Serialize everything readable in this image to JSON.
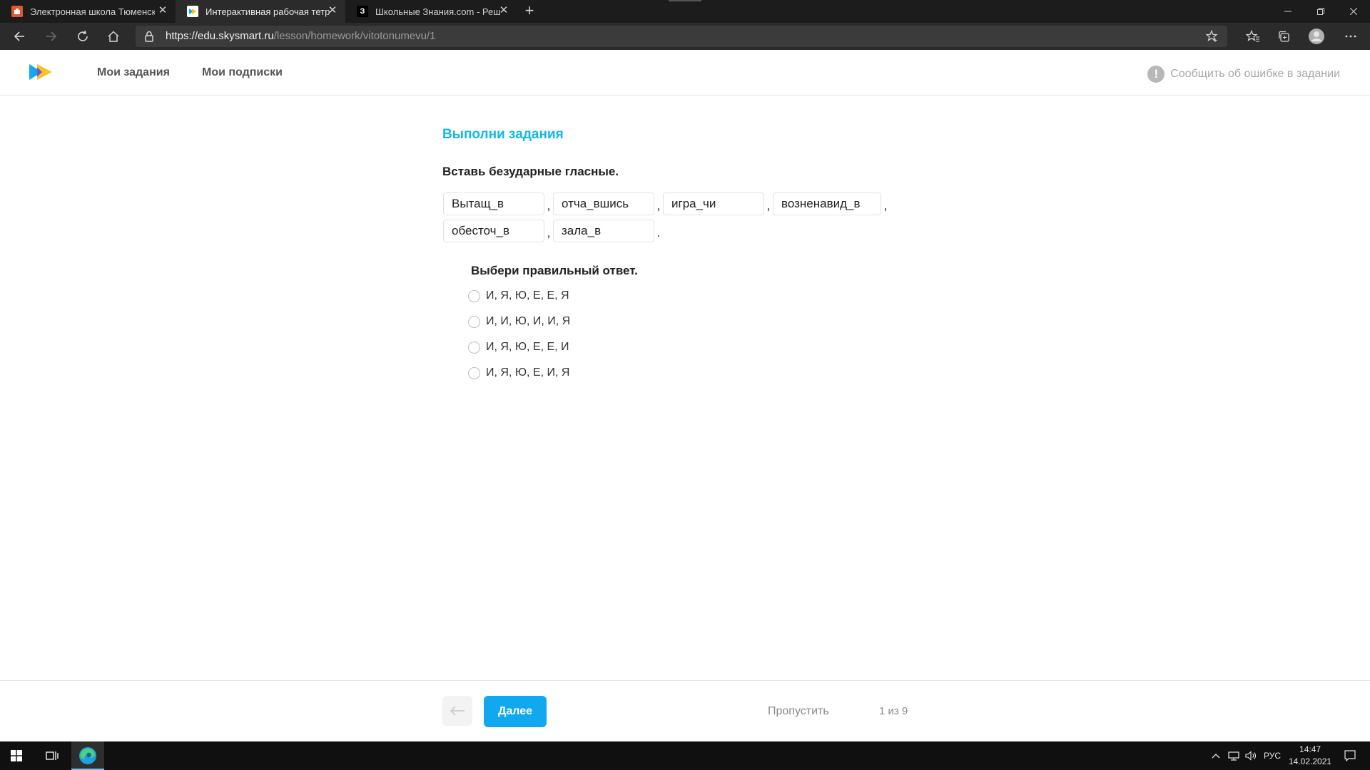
{
  "browser": {
    "tabs": [
      {
        "title": "Электронная школа Тюменско",
        "favicon_color": "#e2582c",
        "active": false
      },
      {
        "title": "Интерактивная рабочая тетрад",
        "favicon_color": "#ffffff",
        "active": true
      },
      {
        "title": "Школьные Знания.com - Решае",
        "favicon_color": "#000000",
        "favicon_letter": "З",
        "active": false
      }
    ],
    "url_host": "https://edu.skysmart.ru",
    "url_path": "/lesson/homework/vitotonumevu/1"
  },
  "header": {
    "nav": [
      "Мои задания",
      "Мои подписки"
    ],
    "report_label": "Сообщить об ошибке в задании"
  },
  "task": {
    "title": "Выполни задания",
    "instruction": "Вставь безударные гласные.",
    "words_row1": [
      "Вытащ_в",
      "отча_вшись",
      "игра_чи",
      "возненавид_в"
    ],
    "words_row2": [
      "обесточ_в",
      "зала_в"
    ],
    "question": "Выбери правильный ответ.",
    "options": [
      "И, Я, Ю, Е, Е, Я",
      "И, И, Ю, И, И, Я",
      "И, Я, Ю, Е, Е, И",
      "И, Я, Ю, Е, И, Я"
    ]
  },
  "footer": {
    "next_label": "Далее",
    "skip_label": "Пропустить",
    "counter": "1 из 9"
  },
  "taskbar": {
    "lang": "РУС",
    "time": "14:47",
    "date": "14.02.2021"
  },
  "colors": {
    "accent": "#12b8e6",
    "button": "#12a8ef"
  }
}
